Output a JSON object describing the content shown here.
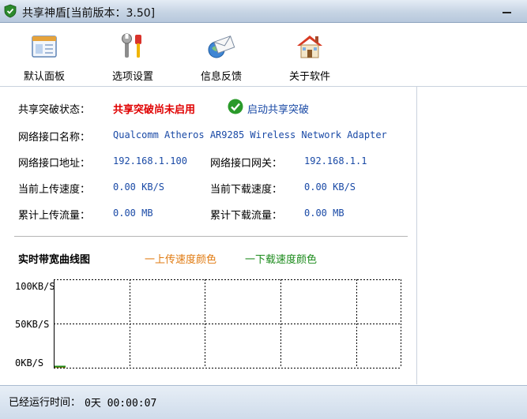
{
  "window": {
    "title": "共享神盾[当前版本：3.50]"
  },
  "toolbar": {
    "items": [
      {
        "label": "默认面板",
        "icon": "panel-window-icon"
      },
      {
        "label": "选项设置",
        "icon": "tools-settings-icon"
      },
      {
        "label": "信息反馈",
        "icon": "mail-feedback-icon"
      },
      {
        "label": "关于软件",
        "icon": "house-about-icon"
      }
    ]
  },
  "status": {
    "label": "共享突破状态：",
    "value": "共享突破尚未启用",
    "enable_label": "启动共享突破"
  },
  "network": {
    "name_label": "网络接口名称：",
    "name": "Qualcomm Atheros AR9285 Wireless Network Adapter",
    "address_label": "网络接口地址：",
    "address": "192.168.1.100",
    "gateway_label": "网络接口网关：",
    "gateway": "192.168.1.1",
    "upload_speed_label": "当前上传速度：",
    "upload_speed": "0.00 KB/S",
    "download_speed_label": "当前下载速度：",
    "download_speed": "0.00 KB/S",
    "total_upload_label": "累计上传流量：",
    "total_upload": "0.00 MB",
    "total_download_label": "累计下载流量：",
    "total_download": "0.00 MB"
  },
  "chart": {
    "title": "实时带宽曲线图",
    "legend_upload": "一上传速度颜色",
    "legend_download": "一下载速度颜色",
    "upload_color": "#e07a10",
    "download_color": "#1a8a1a"
  },
  "chart_data": {
    "type": "line",
    "title": "实时带宽曲线图",
    "xlabel": "",
    "ylabel": "",
    "ylim": [
      0,
      100
    ],
    "yticks": [
      "100KB/S",
      "50KB/S",
      "0KB/S"
    ],
    "grid": true,
    "legend_placement": "top",
    "series": [
      {
        "name": "一上传速度颜色",
        "color": "#e07a10",
        "values": [
          0,
          0
        ]
      },
      {
        "name": "一下载速度颜色",
        "color": "#1a8a1a",
        "values": [
          0,
          0
        ]
      }
    ]
  },
  "statusbar": {
    "runtime_label": "已经运行时间：",
    "runtime_value": "0天 00:00:07"
  }
}
